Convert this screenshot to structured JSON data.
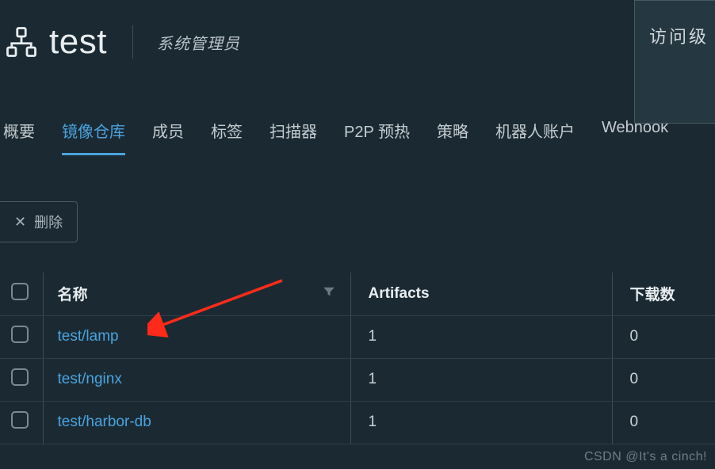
{
  "header": {
    "title": "test",
    "subtitle": "系统管理员"
  },
  "top_panel": {
    "label": "访问级"
  },
  "tabs": [
    {
      "label": "概要",
      "active": false
    },
    {
      "label": "镜像仓库",
      "active": true
    },
    {
      "label": "成员",
      "active": false
    },
    {
      "label": "标签",
      "active": false
    },
    {
      "label": "扫描器",
      "active": false
    },
    {
      "label": "P2P 预热",
      "active": false
    },
    {
      "label": "策略",
      "active": false
    },
    {
      "label": "机器人账户",
      "active": false
    },
    {
      "label": "Webhook",
      "active": false
    }
  ],
  "toolbar": {
    "delete_label": "删除"
  },
  "columns": {
    "name": "名称",
    "artifacts": "Artifacts",
    "downloads": "下载数"
  },
  "rows": [
    {
      "name": "test/lamp",
      "artifacts": "1",
      "downloads": "0"
    },
    {
      "name": "test/nginx",
      "artifacts": "1",
      "downloads": "0"
    },
    {
      "name": "test/harbor-db",
      "artifacts": "1",
      "downloads": "0"
    }
  ],
  "watermark": "CSDN @It's a cinch!"
}
